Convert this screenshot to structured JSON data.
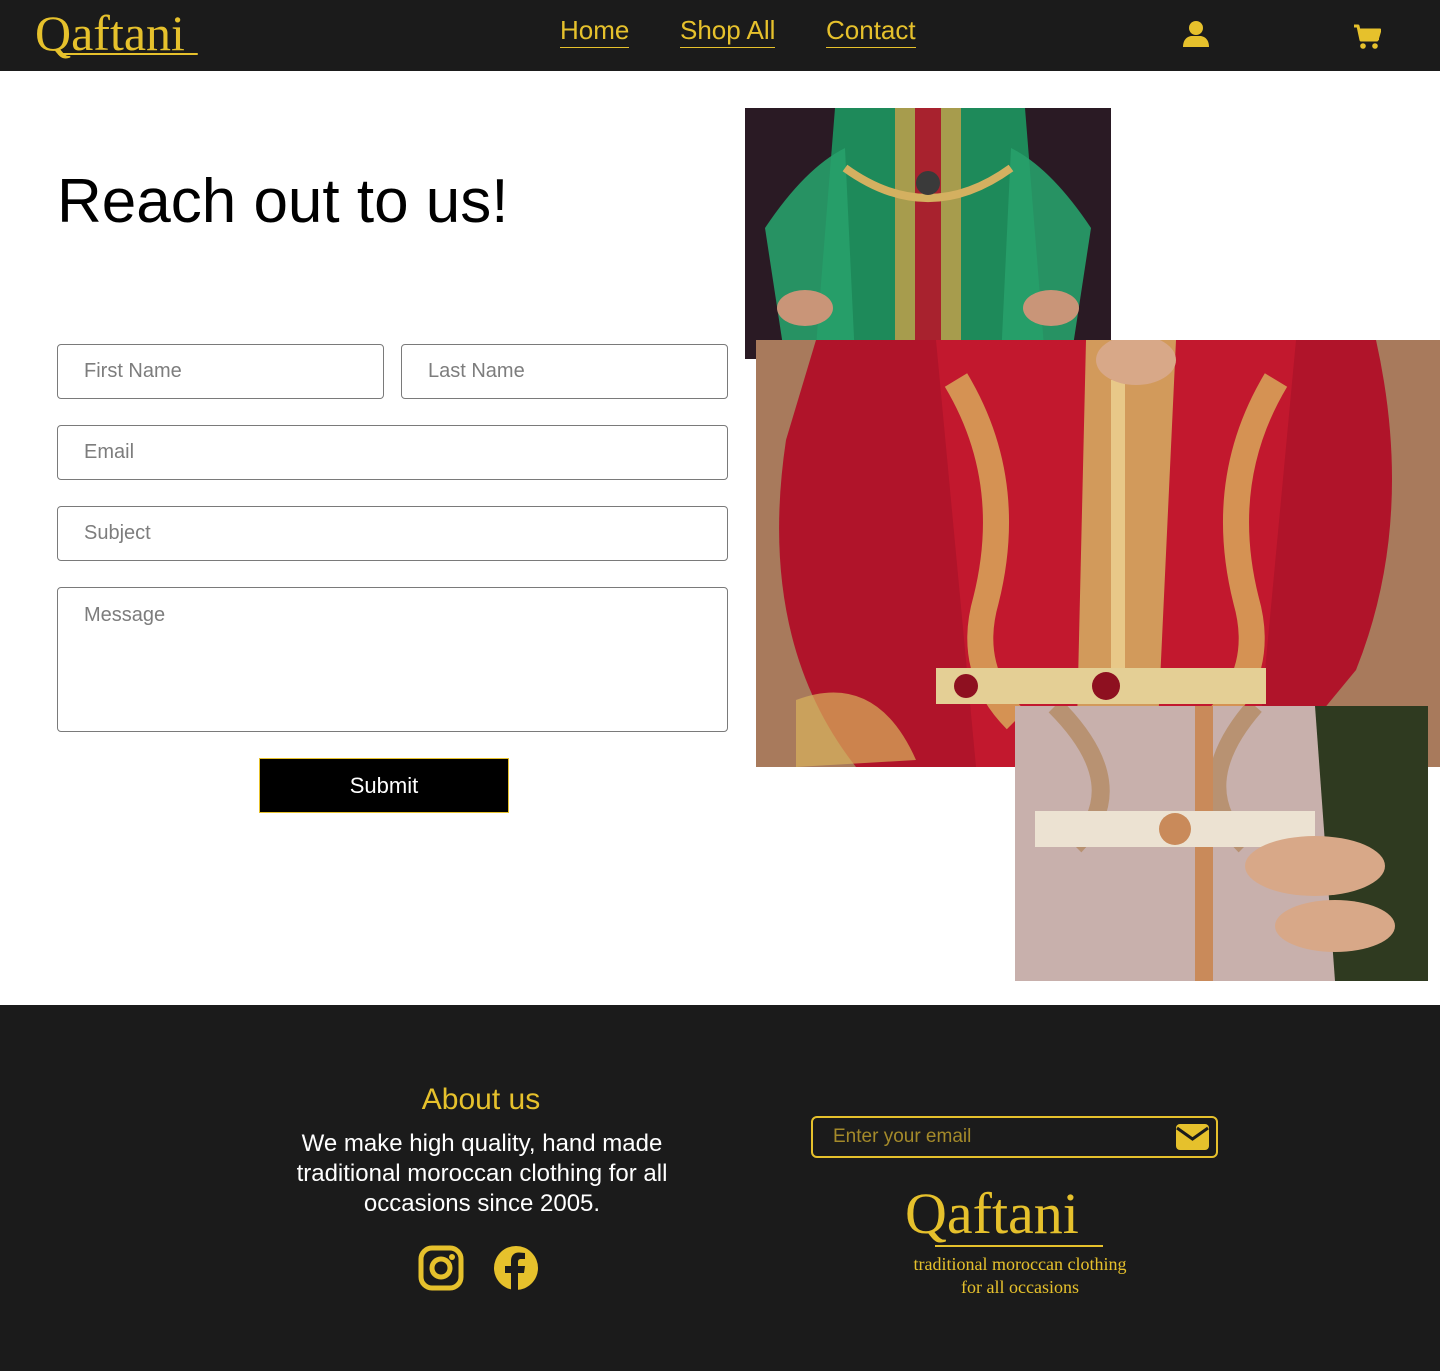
{
  "header": {
    "logo": "Qaftani",
    "nav": [
      "Home",
      "Shop All",
      "Contact"
    ],
    "icons": [
      "user-icon",
      "cart-icon"
    ],
    "accent_color": "#e6c12c",
    "background_color": "#1b1b1b"
  },
  "main": {
    "title": "Reach out to us!",
    "form": {
      "first_name_placeholder": "First Name",
      "last_name_placeholder": "Last Name",
      "email_placeholder": "Email",
      "subject_placeholder": "Subject",
      "message_placeholder": "Message",
      "submit_label": "Submit"
    }
  },
  "footer": {
    "about_title": "About us",
    "about_text": "We make high quality, hand made traditional moroccan clothing for all occasions since 2005.",
    "social_icons": [
      "instagram-icon",
      "facebook-icon"
    ],
    "newsletter_placeholder": "Enter your email",
    "logo": "Qaftani",
    "tagline_line1": "traditional moroccan clothing",
    "tagline_line2": "for all occasions"
  }
}
